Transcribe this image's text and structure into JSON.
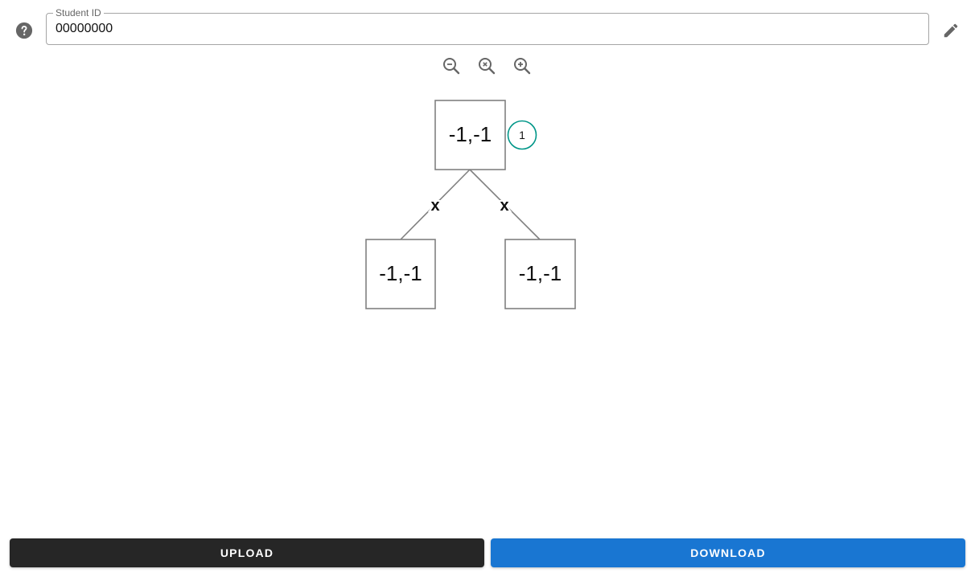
{
  "student_field": {
    "label": "Student ID",
    "value": "00000000"
  },
  "icons": {
    "help": "help-circle-icon",
    "edit": "pencil-icon",
    "zoom_out": "zoom-out-icon",
    "zoom_reset": "zoom-reset-icon",
    "zoom_in": "zoom-in-icon"
  },
  "tree": {
    "root": {
      "label": "-1,-1",
      "badge": "1"
    },
    "edges": [
      {
        "label": "x"
      },
      {
        "label": "x"
      }
    ],
    "children": [
      {
        "label": "-1,-1"
      },
      {
        "label": "-1,-1"
      }
    ]
  },
  "actions": {
    "upload_label": "UPLOAD",
    "download_label": "DOWNLOAD"
  },
  "colors": {
    "badge_ring": "#009688",
    "download_bg": "#1976d2",
    "upload_bg": "#262626",
    "node_border": "#808080"
  }
}
